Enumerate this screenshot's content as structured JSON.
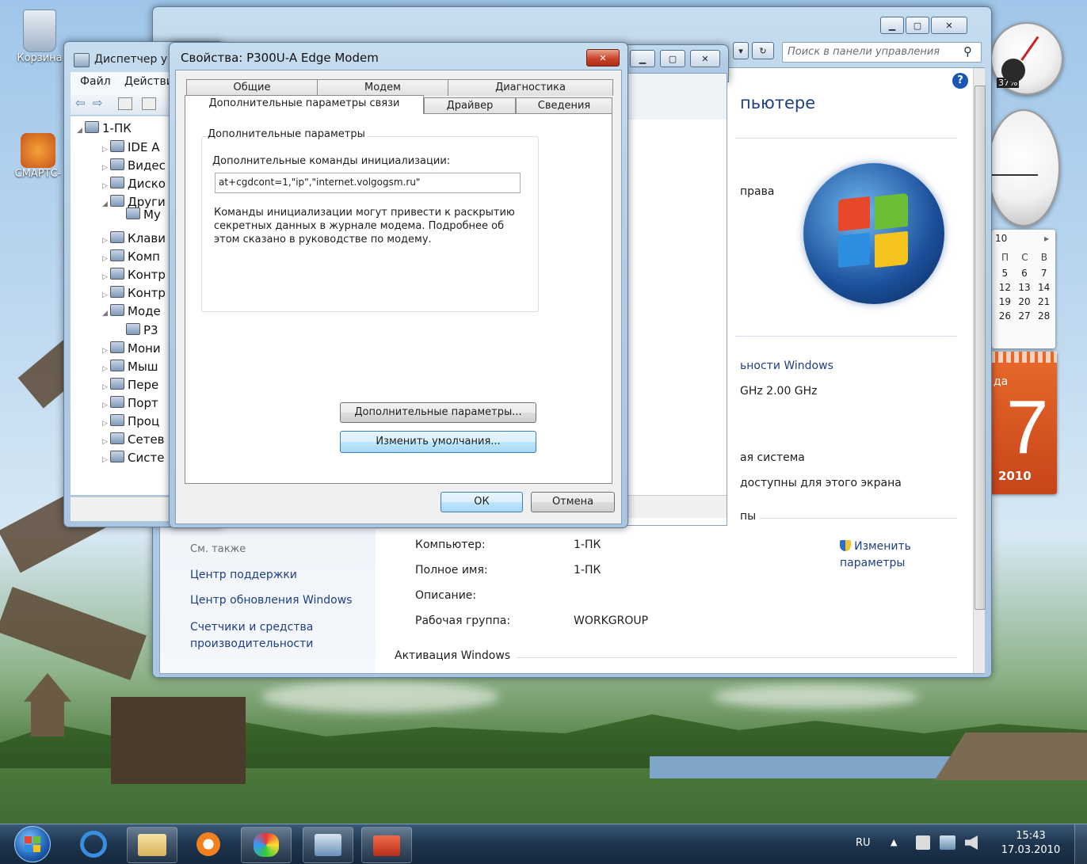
{
  "desktop": {
    "icons": [
      {
        "label": "Корзина",
        "icon": "recycle-bin-icon"
      },
      {
        "label": "СМАРТС-",
        "icon": "smarts-icon"
      }
    ]
  },
  "control_panel": {
    "search_placeholder": "Поиск в панели управления",
    "heading_fragment": "пьютере",
    "rights_fragment": "права",
    "windows_rating_fragment": "ьности Windows",
    "cpu_fragment": "GHz  2.00 GHz",
    "system_type_fragment": "ая система",
    "pen_fragment": "доступны для этого экрана",
    "group_fragment": "пы",
    "see_also": {
      "title": "См. также",
      "links": [
        "Центр поддержки",
        "Центр обновления Windows",
        "Счетчики и средства производительности"
      ]
    },
    "computer_info": [
      {
        "label": "Компьютер:",
        "value": "1-ПК"
      },
      {
        "label": "Полное имя:",
        "value": "1-ПК"
      },
      {
        "label": "Описание:",
        "value": ""
      },
      {
        "label": "Рабочая группа:",
        "value": "WORKGROUP"
      }
    ],
    "change_params": "Изменить параметры",
    "activation": "Активация Windows"
  },
  "device_manager": {
    "title": "Диспетчер у",
    "menu": [
      "Файл",
      "Действи"
    ],
    "root": "1-ПК",
    "items": [
      "IDE A",
      "Видес",
      "Диско",
      "Други",
      "My",
      "Клави",
      "Комп",
      "Контр",
      "Контр",
      "Моде",
      "P3",
      "Мони",
      "Мыш",
      "Пере",
      "Порт",
      "Проц",
      "Сетев",
      "Систе"
    ]
  },
  "dialog": {
    "title": "Свойства: P300U-A Edge Modem",
    "tabs_row1": [
      "Общие",
      "Модем",
      "Диагностика"
    ],
    "tabs_row2": [
      "Дополнительные параметры связи",
      "Драйвер",
      "Сведения"
    ],
    "group_title": "Дополнительные параметры",
    "init_label": "Дополнительные команды инициализации:",
    "init_value": "at+cgdcont=1,\"ip\",\"internet.volgogsm.ru\"",
    "warning": "Команды инициализации могут привести к раскрытию секретных данных в журнале модема. Подробнее об этом сказано в руководстве по модему.",
    "advanced_button": "Дополнительные параметры...",
    "defaults_button": "Изменить умолчания...",
    "ok": "ОК",
    "cancel": "Отмена"
  },
  "gadgets": {
    "cpu_percent": "37%",
    "calendar_month_fragment": "10",
    "calendar_header": [
      "П",
      "С",
      "В"
    ],
    "calendar_rows": [
      [
        "5",
        "6",
        "7"
      ],
      [
        "12",
        "13",
        "14"
      ],
      [
        "19",
        "20",
        "21"
      ],
      [
        "26",
        "27",
        "28"
      ]
    ],
    "date_fragment": "да",
    "day": "7",
    "year": "2010"
  },
  "taskbar": {
    "lang": "RU",
    "time": "15:43",
    "date": "17.03.2010"
  }
}
